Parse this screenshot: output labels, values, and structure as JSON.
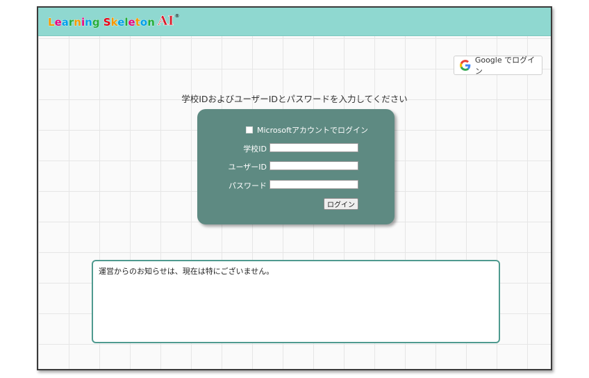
{
  "header": {
    "logo": {
      "letters": [
        {
          "char": "L",
          "color": "#f39800"
        },
        {
          "char": "e",
          "color": "#e4007f"
        },
        {
          "char": "a",
          "color": "#009fe8"
        },
        {
          "char": "r",
          "color": "#22ac38"
        },
        {
          "char": "n",
          "color": "#f39800"
        },
        {
          "char": "i",
          "color": "#e4007f"
        },
        {
          "char": "n",
          "color": "#009fe8"
        },
        {
          "char": "g",
          "color": "#22ac38"
        },
        {
          "char": " ",
          "color": "#000"
        },
        {
          "char": "S",
          "color": "#e60012"
        },
        {
          "char": "k",
          "color": "#f39800"
        },
        {
          "char": "e",
          "color": "#009fe8"
        },
        {
          "char": "l",
          "color": "#22ac38"
        },
        {
          "char": "e",
          "color": "#e4007f"
        },
        {
          "char": "t",
          "color": "#f39800"
        },
        {
          "char": "o",
          "color": "#009fe8"
        },
        {
          "char": "n",
          "color": "#22ac38"
        }
      ],
      "ai": "AI",
      "reg": "®"
    }
  },
  "google_button": {
    "label": "Google でログイン",
    "icon": "google-g-icon"
  },
  "instructions": "学校IDおよびユーザーIDとパスワードを入力してください",
  "login_form": {
    "microsoft_label": "Microsoftアカウントでログイン",
    "microsoft_checked": false,
    "school_id_label": "学校ID",
    "school_id_value": "",
    "user_id_label": "ユーザーID",
    "user_id_value": "",
    "password_label": "パスワード",
    "password_value": "",
    "submit_label": "ログイン"
  },
  "notice": {
    "text": "運営からのお知らせは、現在は特にございません。"
  },
  "colors": {
    "header_bg": "#8fd8d0",
    "login_box_bg": "#5e8a82",
    "notice_border": "#4f9a8f"
  }
}
